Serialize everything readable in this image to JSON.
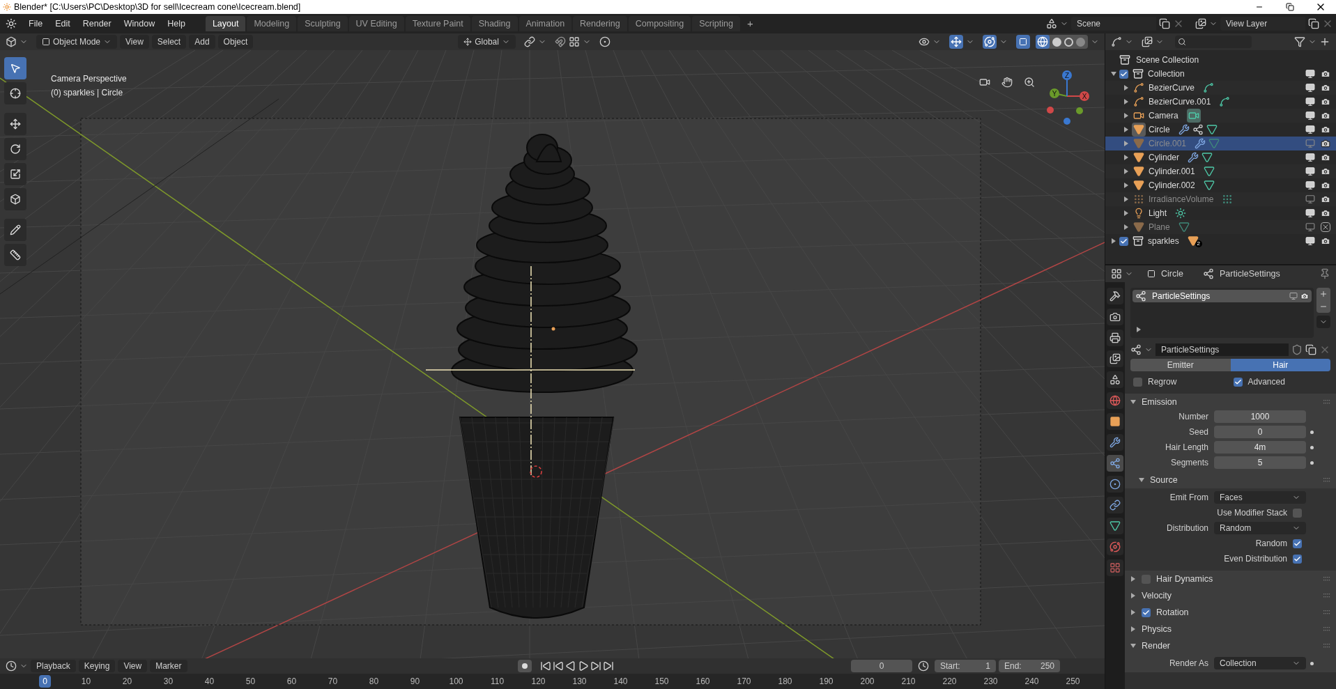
{
  "window": {
    "title": "Blender* [C:\\Users\\PC\\Desktop\\3D for sell\\Icecream cone\\Icecream.blend]"
  },
  "menu": [
    "File",
    "Edit",
    "Render",
    "Window",
    "Help"
  ],
  "workspaces": [
    {
      "label": "Layout",
      "selected": true
    },
    {
      "label": "Modeling",
      "selected": false
    },
    {
      "label": "Sculpting",
      "selected": false
    },
    {
      "label": "UV Editing",
      "selected": false
    },
    {
      "label": "Texture Paint",
      "selected": false
    },
    {
      "label": "Shading",
      "selected": false
    },
    {
      "label": "Animation",
      "selected": false
    },
    {
      "label": "Rendering",
      "selected": false
    },
    {
      "label": "Compositing",
      "selected": false
    },
    {
      "label": "Scripting",
      "selected": false
    }
  ],
  "add_workspace": "+",
  "scene": "Scene",
  "view_layer": "View Layer",
  "viewport_header": {
    "mode": "Object Mode",
    "menus": [
      "View",
      "Select",
      "Add",
      "Object"
    ],
    "orientation": "Global"
  },
  "viewport": {
    "camera_label": "Camera Perspective",
    "object_label": "(0) sparkles | Circle",
    "gizmo_axes": [
      "X",
      "Y",
      "Z"
    ]
  },
  "outliner": {
    "root": "Scene Collection",
    "items": [
      {
        "name": "Collection",
        "kind": "collection",
        "checked": true,
        "expanded": true,
        "children": [
          {
            "name": "BezierCurve",
            "kind": "curve",
            "selected": false,
            "active": false,
            "visible": true,
            "renderable": true,
            "has_modifier": false,
            "has_particles": false
          },
          {
            "name": "BezierCurve.001",
            "kind": "curve",
            "selected": false,
            "active": false,
            "visible": true,
            "renderable": true,
            "has_modifier": false,
            "has_particles": false
          },
          {
            "name": "Camera",
            "kind": "camera",
            "selected": false,
            "active": false,
            "visible": true,
            "renderable": true,
            "has_modifier": false,
            "has_particles": false
          },
          {
            "name": "Circle",
            "kind": "mesh",
            "selected": false,
            "active": true,
            "visible": true,
            "renderable": true,
            "has_modifier": true,
            "has_particles": true
          },
          {
            "name": "Circle.001",
            "kind": "mesh",
            "selected": true,
            "active": false,
            "visible": false,
            "renderable": true,
            "has_modifier": true,
            "has_particles": false
          },
          {
            "name": "Cylinder",
            "kind": "mesh",
            "selected": false,
            "active": false,
            "visible": true,
            "renderable": true,
            "has_modifier": true,
            "has_particles": false
          },
          {
            "name": "Cylinder.001",
            "kind": "mesh",
            "selected": false,
            "active": false,
            "visible": true,
            "renderable": true,
            "has_modifier": false,
            "has_particles": false
          },
          {
            "name": "Cylinder.002",
            "kind": "mesh",
            "selected": false,
            "active": false,
            "visible": true,
            "renderable": true,
            "has_modifier": false,
            "has_particles": false
          },
          {
            "name": "IrradianceVolume",
            "kind": "probe",
            "selected": false,
            "active": false,
            "visible": false,
            "renderable": true,
            "has_modifier": false,
            "has_particles": false
          },
          {
            "name": "Light",
            "kind": "light",
            "selected": false,
            "active": false,
            "visible": true,
            "renderable": true,
            "has_modifier": false,
            "has_particles": false
          },
          {
            "name": "Plane",
            "kind": "mesh",
            "selected": false,
            "active": false,
            "visible": false,
            "renderable": false,
            "has_modifier": false,
            "has_particles": false
          }
        ]
      },
      {
        "name": "sparkles",
        "kind": "collection",
        "checked": true,
        "expanded": false,
        "badge": "2"
      }
    ]
  },
  "properties": {
    "object": "Circle",
    "data": "ParticleSettings",
    "tabs": [
      {
        "kind": "tool",
        "selected": false
      },
      {
        "kind": "render",
        "selected": false
      },
      {
        "kind": "output",
        "selected": false
      },
      {
        "kind": "view_layer",
        "selected": false
      },
      {
        "kind": "scene",
        "selected": false
      },
      {
        "kind": "world",
        "selected": false
      },
      {
        "kind": "object",
        "selected": false
      },
      {
        "kind": "modifiers",
        "selected": false
      },
      {
        "kind": "particles",
        "selected": true
      },
      {
        "kind": "physics",
        "selected": false
      },
      {
        "kind": "constraints",
        "selected": false
      },
      {
        "kind": "data",
        "selected": false
      },
      {
        "kind": "material",
        "selected": false
      },
      {
        "kind": "texture",
        "selected": false
      }
    ],
    "systems": [
      {
        "name": "ParticleSettings",
        "selected": true
      }
    ],
    "datablock": "ParticleSettings",
    "types": [
      {
        "label": "Emitter",
        "selected": false
      },
      {
        "label": "Hair",
        "selected": true
      }
    ],
    "toggles": [
      {
        "label": "Regrow",
        "checked": false
      },
      {
        "label": "Advanced",
        "checked": true
      }
    ],
    "emission": {
      "title": "Emission",
      "expanded": true,
      "fields": [
        {
          "label": "Number",
          "value": "1000",
          "animatable": false
        },
        {
          "label": "Seed",
          "value": "0",
          "animatable": true
        },
        {
          "label": "Hair Length",
          "value": "4m",
          "animatable": true
        },
        {
          "label": "Segments",
          "value": "5",
          "animatable": true
        }
      ]
    },
    "source": {
      "title": "Source",
      "expanded": true,
      "rows": [
        {
          "kind": "dropdown",
          "label": "Emit From",
          "value": "Faces"
        },
        {
          "kind": "checkbox",
          "label": "Use Modifier Stack",
          "checked": false
        },
        {
          "kind": "dropdown",
          "label": "Distribution",
          "value": "Random"
        },
        {
          "kind": "checkbox",
          "label": "Random",
          "checked": true
        },
        {
          "kind": "checkbox",
          "label": "Even Distribution",
          "checked": true
        }
      ]
    },
    "panels": [
      {
        "title": "Hair Dynamics",
        "expanded": false,
        "checked": false
      },
      {
        "title": "Velocity",
        "expanded": false
      },
      {
        "title": "Rotation",
        "expanded": false,
        "checked": true
      },
      {
        "title": "Physics",
        "expanded": false
      },
      {
        "title": "Render",
        "expanded": true
      }
    ],
    "render_as": {
      "label": "Render As",
      "value": "Collection"
    }
  },
  "timeline": {
    "menus": [
      "Playback",
      "Keying",
      "View",
      "Marker"
    ],
    "current": "0",
    "start_label": "Start:",
    "start": "1",
    "end_label": "End:",
    "end": "250",
    "frames": [
      {
        "label": "0",
        "selected": true
      },
      {
        "label": "10",
        "selected": false
      },
      {
        "label": "20",
        "selected": false
      },
      {
        "label": "30",
        "selected": false
      },
      {
        "label": "40",
        "selected": false
      },
      {
        "label": "50",
        "selected": false
      },
      {
        "label": "60",
        "selected": false
      },
      {
        "label": "70",
        "selected": false
      },
      {
        "label": "80",
        "selected": false
      },
      {
        "label": "90",
        "selected": false
      },
      {
        "label": "100",
        "selected": false
      },
      {
        "label": "110",
        "selected": false
      },
      {
        "label": "120",
        "selected": false
      },
      {
        "label": "130",
        "selected": false
      },
      {
        "label": "140",
        "selected": false
      },
      {
        "label": "150",
        "selected": false
      },
      {
        "label": "160",
        "selected": false
      },
      {
        "label": "170",
        "selected": false
      },
      {
        "label": "180",
        "selected": false
      },
      {
        "label": "190",
        "selected": false
      },
      {
        "label": "200",
        "selected": false
      },
      {
        "label": "210",
        "selected": false
      },
      {
        "label": "220",
        "selected": false
      },
      {
        "label": "230",
        "selected": false
      },
      {
        "label": "240",
        "selected": false
      },
      {
        "label": "250",
        "selected": false
      }
    ]
  }
}
